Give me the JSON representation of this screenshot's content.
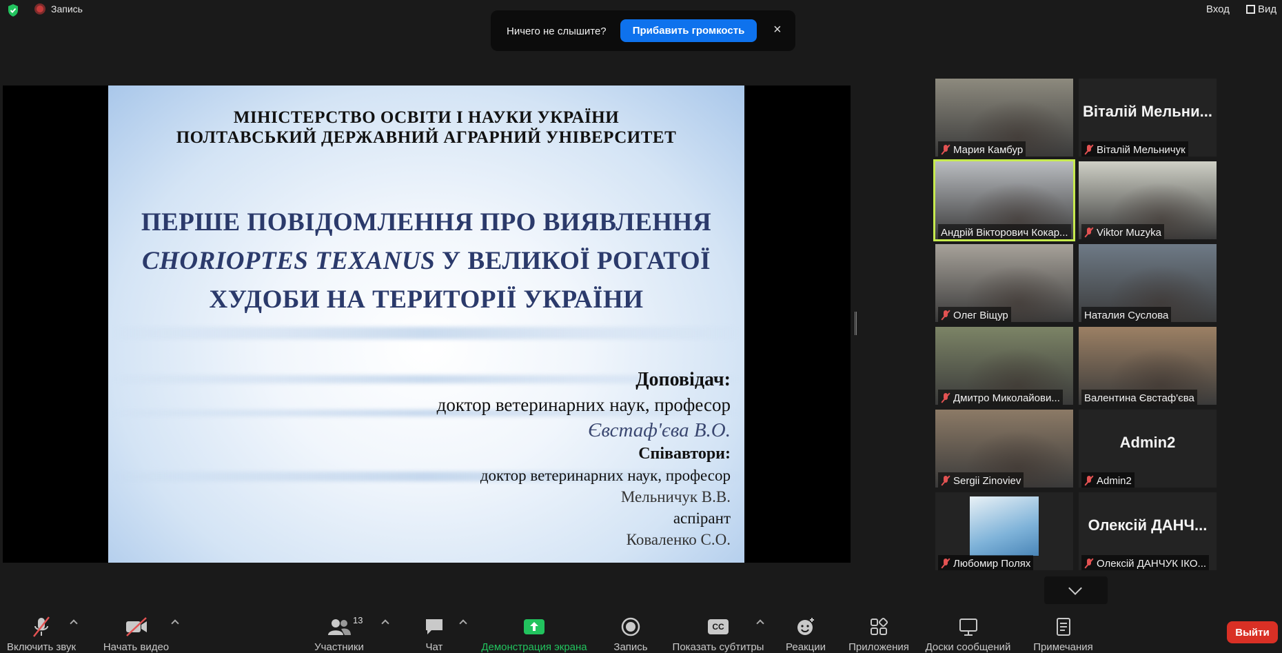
{
  "top": {
    "record_label": "Запись",
    "login_label": "Вход",
    "view_label": "Вид"
  },
  "toast": {
    "text": "Ничего не слышите?",
    "button": "Прибавить громкость",
    "close": "×"
  },
  "slide": {
    "ministry_1": "МІНІСТЕРСТВО ОСВІТИ І НАУКИ УКРАЇНИ",
    "ministry_2": "ПОЛТАВСЬКИЙ ДЕРЖАВНИЙ АГРАРНИЙ УНІВЕРСИТЕТ",
    "title_1": "ПЕРШЕ ПОВІДОМЛЕННЯ ПРО ВИЯВЛЕННЯ",
    "title_2_italic": "CHORIOPTES TEXANUS",
    "title_2_rest": " У ВЕЛИКОЇ РОГАТОЇ",
    "title_3": "ХУДОБИ НА ТЕРИТОРІЇ УКРАЇНИ",
    "speaker_heading": "Доповідач:",
    "speaker_degree": "доктор ветеринарних наук, професор",
    "speaker_name": "Євстаф'єва В.О.",
    "coauthors_heading": "Співавтори:",
    "coauthor1_degree": "доктор ветеринарних наук, професор",
    "coauthor1_name": "Мельничук В.В.",
    "coauthor2_degree": "аспірант",
    "coauthor2_name": "Коваленко С.О."
  },
  "participants": [
    {
      "name": "Мария Камбур",
      "muted": true,
      "video": true,
      "bg": "#8d8a7e"
    },
    {
      "name": "Віталій Мельничук",
      "big": "Віталій Мельни...",
      "muted": true,
      "video": false
    },
    {
      "name": "Андрій Вікторович Кокар...",
      "muted": false,
      "video": true,
      "bg": "#b9bcc0"
    },
    {
      "name": "Viktor Muzyka",
      "muted": true,
      "video": true,
      "bg": "#cfd0c6"
    },
    {
      "name": "Олег Віщур",
      "muted": true,
      "video": true,
      "bg": "#a7a29a"
    },
    {
      "name": "Наталия Суслова",
      "muted": false,
      "video": true,
      "bg": "#6e7a86"
    },
    {
      "name": "Дмитро Миколайови...",
      "muted": true,
      "video": true,
      "bg": "#7c8466"
    },
    {
      "name": "Валентина Євстаф'єва",
      "muted": false,
      "video": true,
      "bg": "#9c8064"
    },
    {
      "name": "Sergii Zinoviev",
      "muted": true,
      "video": true,
      "bg": "#8c7a66"
    },
    {
      "name": "Admin2",
      "big": "Admin2",
      "muted": true,
      "video": false
    },
    {
      "name": "Любомир Полях",
      "muted": true,
      "video": true,
      "bg": "#232323"
    },
    {
      "name": "Олексій ДАНЧУК ІКО...",
      "big": "Олексій ДАНЧ...",
      "muted": true,
      "video": false
    }
  ],
  "toolbar": {
    "unmute": "Включить звук",
    "start_video": "Начать видео",
    "participants": "Участники",
    "participants_count": "13",
    "chat": "Чат",
    "share": "Демонстрация экрана",
    "record": "Запись",
    "captions": "Показать субтитры",
    "captions_icon": "CC",
    "reactions": "Реакции",
    "apps": "Приложения",
    "whiteboards": "Доски сообщений",
    "notes": "Примечания",
    "leave": "Выйти"
  },
  "colors": {
    "accent_blue": "#0e72ed",
    "leave_red": "#d93025",
    "share_green": "#22c35e",
    "active_speaker": "#c6ea4e",
    "slide_title": "#2b3a6b"
  }
}
